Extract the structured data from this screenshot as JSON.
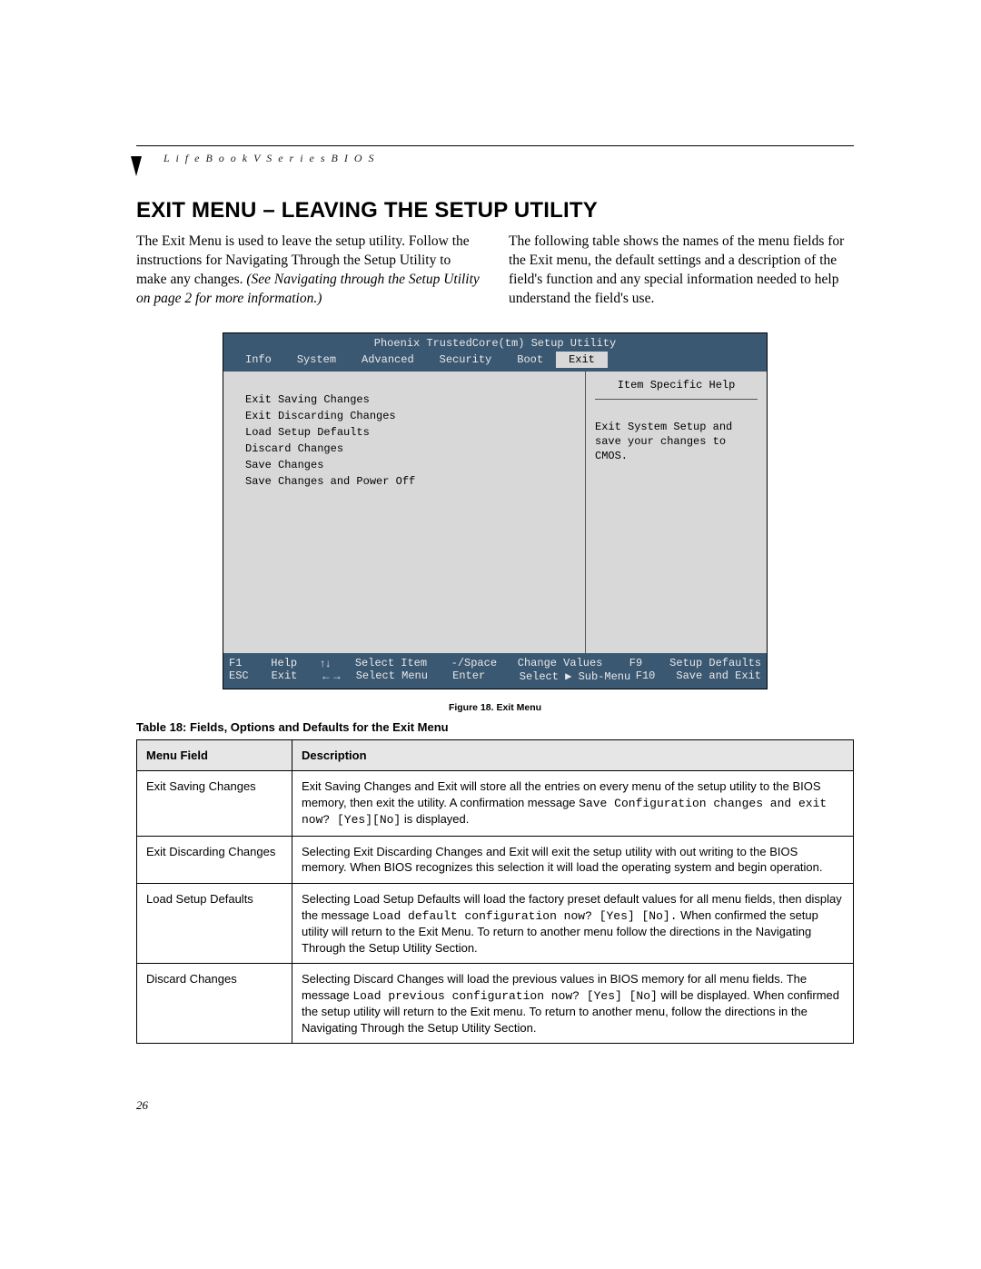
{
  "header": "L i f e B o o k  V  S e r i e s  B I O S",
  "title": "EXIT MENU – LEAVING THE SETUP UTILITY",
  "intro_left_1": "The Exit Menu is used to leave the setup utility. Follow the instructions for Navigating Through the Setup Utility to make any changes. ",
  "intro_left_em": "(See Navigating through the Setup Utility on page 2 for more information.)",
  "intro_right": "The following table shows the names of the menu fields for the Exit menu, the default settings and a description of the field's function and any special information needed to help understand the field's use.",
  "bios": {
    "title": "Phoenix TrustedCore(tm) Setup Utility",
    "tabs": [
      "Info",
      "System",
      "Advanced",
      "Security",
      "Boot",
      "Exit"
    ],
    "active_tab": "Exit",
    "menu_items": [
      "Exit Saving Changes",
      "Exit Discarding Changes",
      "Load Setup Defaults",
      "Discard Changes",
      "Save Changes",
      "Save Changes and Power Off"
    ],
    "help_title": "Item Specific Help",
    "help_text": "Exit System Setup and save your changes to CMOS.",
    "footer": {
      "r1": {
        "k1": "F1",
        "v1": "Help",
        "k2": "↑↓",
        "v2": "Select Item",
        "k3": "-/Space",
        "v3": "Change Values",
        "k4": "F9",
        "v4": "Setup Defaults"
      },
      "r2": {
        "k1": "ESC",
        "v1": "Exit",
        "k2": "←→",
        "v2": "Select Menu",
        "k3": "Enter",
        "v3": "Select ▶ Sub-Menu",
        "k4": "F10",
        "v4": "Save and Exit"
      }
    }
  },
  "fig_caption": "Figure 18.  Exit Menu",
  "tbl_caption": "Table 18: Fields, Options and Defaults for the Exit Menu",
  "table": {
    "headers": [
      "Menu Field",
      "Description"
    ],
    "rows": [
      {
        "field": "Exit Saving Changes",
        "desc_pre": "Exit Saving Changes and Exit will store all the entries on every menu of the setup utility to the BIOS memory, then exit the utility. A confirmation message ",
        "code": "Save Configuration changes and exit now? [Yes][No]",
        "desc_post": " is displayed."
      },
      {
        "field": "Exit Discarding Changes",
        "desc_pre": "Selecting Exit Discarding Changes and Exit will exit the setup utility with out writing to the BIOS memory. When BIOS recognizes this selection it will load the operating system and begin operation.",
        "code": "",
        "desc_post": ""
      },
      {
        "field": "Load Setup Defaults",
        "desc_pre": "Selecting Load Setup Defaults will load the factory preset default values for all menu fields, then display the message ",
        "code": "Load default configuration now? [Yes] [No].",
        "desc_post": " When confirmed the setup utility will return to the Exit Menu. To return to another menu follow the directions in the Navigating Through the Setup Utility Section."
      },
      {
        "field": "Discard Changes",
        "desc_pre": "Selecting Discard Changes will load the previous values in BIOS memory for all menu fields. The message ",
        "code": "Load previous configuration now? [Yes] [No]",
        "desc_post": " will be displayed. When confirmed the setup utility will return to the Exit menu. To return to another menu, follow the directions in the Navigating Through the Setup Utility Section."
      }
    ]
  },
  "page_number": "26"
}
